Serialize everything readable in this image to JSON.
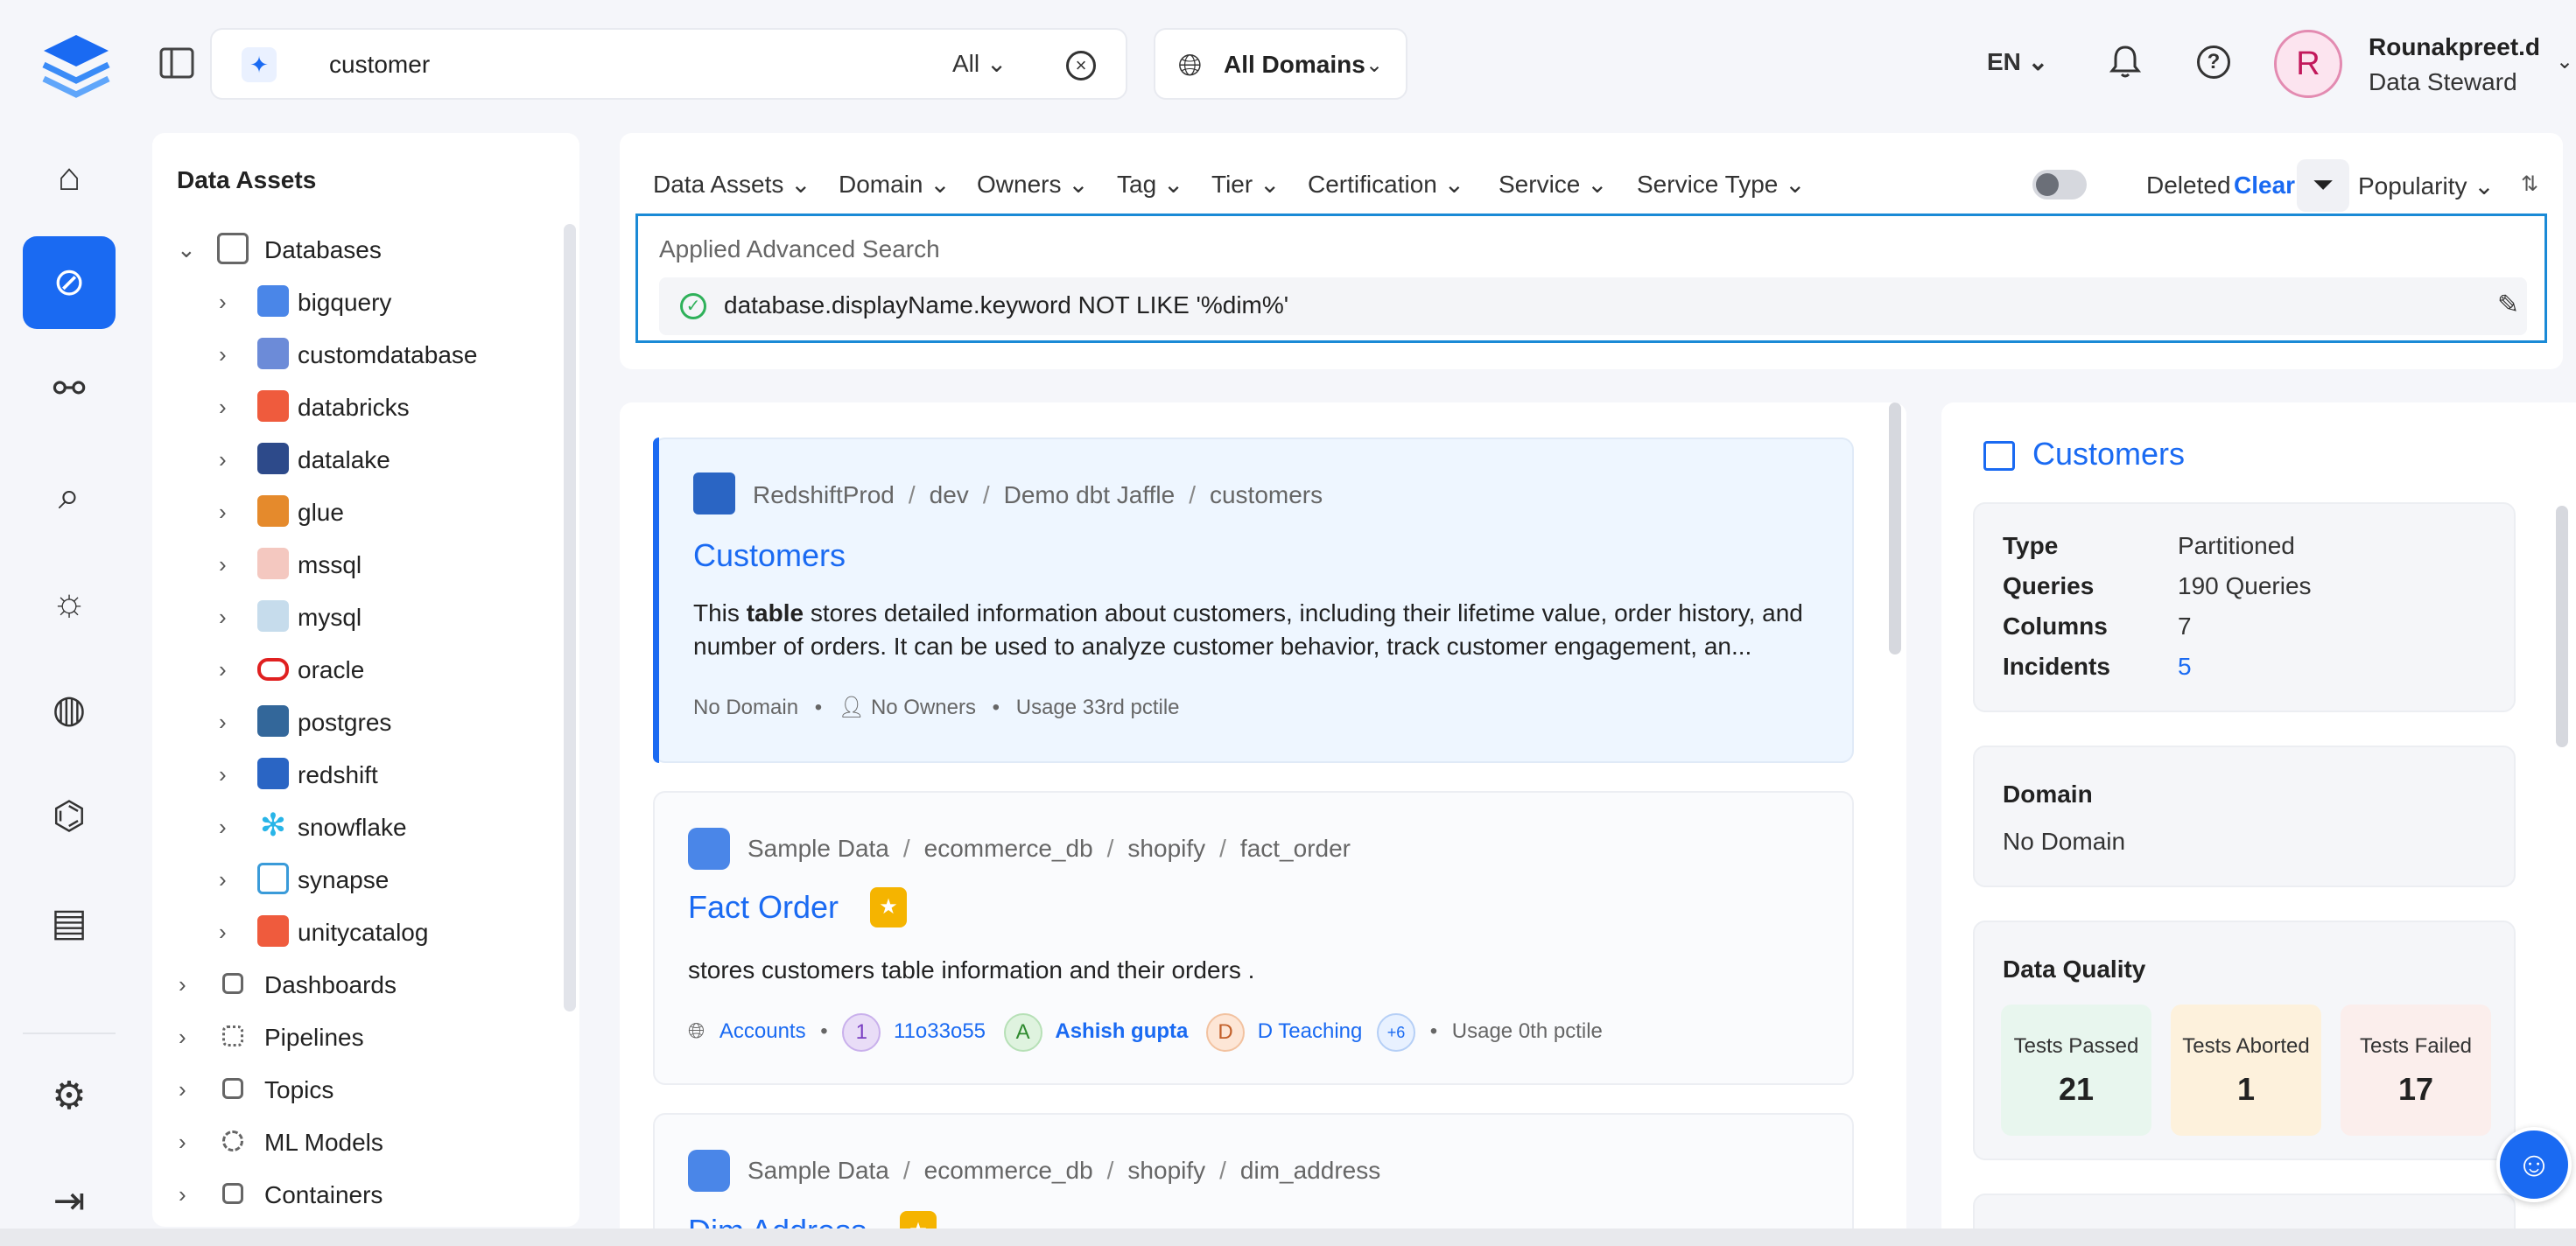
{
  "colors": {
    "accent": "#1a6af2",
    "success": "#2fb15a",
    "tier_badge": "#f5b400"
  },
  "header": {
    "search_value": "customer",
    "search_scope": "All",
    "domain_selector": "All Domains",
    "language": "EN",
    "user": {
      "initial": "R",
      "name": "Rounakpreet.d",
      "role": "Data Steward"
    }
  },
  "nav": {
    "icons": [
      "home-icon",
      "explore-icon",
      "lineage-icon",
      "observability-icon",
      "insights-icon",
      "domains-icon",
      "governance-icon",
      "glossary-icon",
      "settings-icon",
      "logout-icon"
    ],
    "active": "explore-icon"
  },
  "tree": {
    "title": "Data Assets",
    "root": "Databases",
    "services": [
      "bigquery",
      "customdatabase",
      "databricks",
      "datalake",
      "glue",
      "mssql",
      "mysql",
      "oracle",
      "postgres",
      "redshift",
      "snowflake",
      "synapse",
      "unitycatalog"
    ],
    "categories": [
      "Dashboards",
      "Pipelines",
      "Topics",
      "ML Models",
      "Containers"
    ]
  },
  "filters": {
    "items": [
      "Data Assets",
      "Domain",
      "Owners",
      "Tag",
      "Tier",
      "Certification",
      "Service",
      "Service Type"
    ],
    "deleted_label": "Deleted",
    "clear_label": "Clear",
    "sort_label": "Popularity",
    "advanced_title": "Applied Advanced Search",
    "advanced_query": "database.displayName.keyword NOT LIKE '%dim%'"
  },
  "results": [
    {
      "breadcrumb": [
        "RedshiftProd",
        "dev",
        "Demo dbt Jaffle",
        "customers"
      ],
      "title": "Customers",
      "desc_prefix": "This ",
      "desc_bold": "table",
      "desc_rest": " stores detailed information about customers, including their lifetime value, order history, and number of orders. It can be used to analyze customer behavior, track customer engagement, an...",
      "domain": "No Domain",
      "owners": "No Owners",
      "usage": "Usage 33rd pctile"
    },
    {
      "breadcrumb": [
        "Sample Data",
        "ecommerce_db",
        "shopify",
        "fact_order"
      ],
      "title": "Fact Order",
      "desc": "stores customers table information and their orders .",
      "domain": "Accounts",
      "owners": [
        {
          "initial": "1",
          "name": "11o33o55",
          "color": "#e9ddf7",
          "fg": "#7a3fc2"
        },
        {
          "initial": "A",
          "name": "Ashish gupta",
          "color": "#dff3df",
          "fg": "#2f8a2f"
        },
        {
          "initial": "D",
          "name": "D Teaching",
          "color": "#fde6d6",
          "fg": "#c2602a"
        }
      ],
      "more_owners": "+6",
      "usage": "Usage 0th pctile"
    },
    {
      "breadcrumb": [
        "Sample Data",
        "ecommerce_db",
        "shopify",
        "dim_address"
      ],
      "title": "Dim Address"
    }
  ],
  "summary": {
    "title": "Customers",
    "props": [
      {
        "k": "Type",
        "v": "Partitioned"
      },
      {
        "k": "Queries",
        "v": "190 Queries"
      },
      {
        "k": "Columns",
        "v": "7"
      },
      {
        "k": "Incidents",
        "v": "5"
      }
    ],
    "domain_label": "Domain",
    "domain_value": "No Domain",
    "dq_title": "Data Quality",
    "dq": [
      {
        "label": "Tests Passed",
        "value": "21",
        "bg": "#e8f6ee"
      },
      {
        "label": "Tests Aborted",
        "value": "1",
        "bg": "#fdf1dc"
      },
      {
        "label": "Tests Failed",
        "value": "17",
        "bg": "#fbeeec"
      }
    ]
  }
}
